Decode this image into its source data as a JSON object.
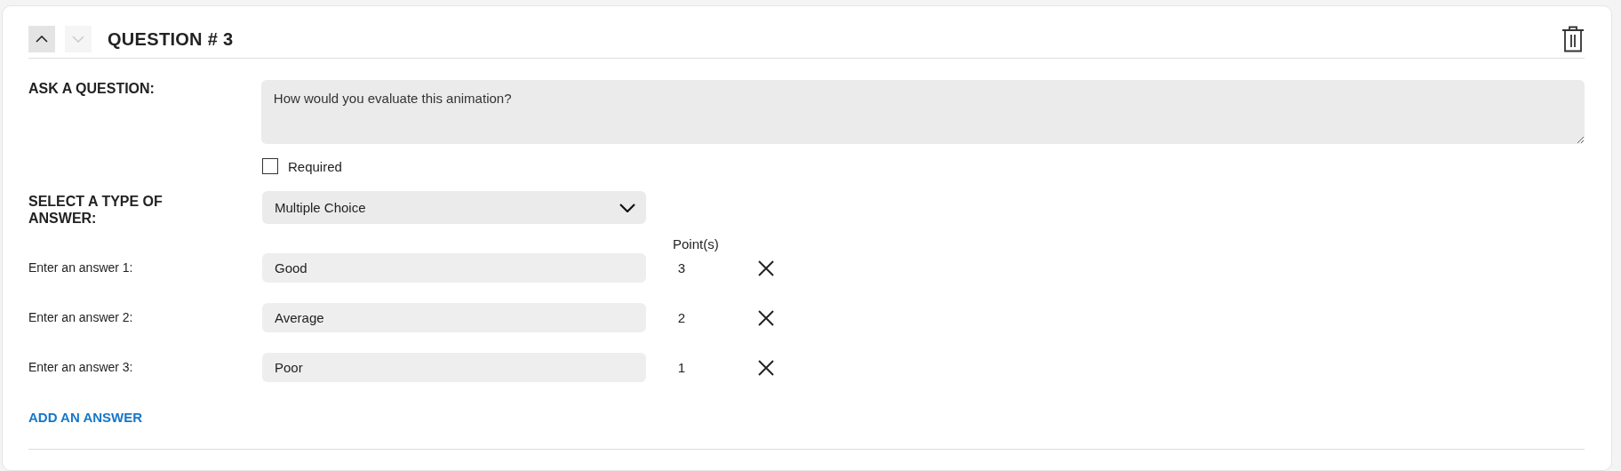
{
  "question": {
    "title": "QUESTION # 3",
    "move_up": {
      "disabled": false
    },
    "move_down": {
      "disabled": true
    }
  },
  "ask": {
    "label": "ASK A QUESTION:",
    "value": "How would you evaluate this animation?"
  },
  "required": {
    "label": "Required",
    "checked": false
  },
  "answer_type": {
    "label": "SELECT A TYPE OF ANSWER:",
    "value": "Multiple Choice"
  },
  "points_header": "Point(s)",
  "answers": [
    {
      "label": "Enter an answer 1:",
      "value": "Good",
      "points": "3"
    },
    {
      "label": "Enter an answer 2:",
      "value": "Average",
      "points": "2"
    },
    {
      "label": "Enter an answer 3:",
      "value": "Poor",
      "points": "1"
    }
  ],
  "add_answer": "ADD AN ANSWER"
}
